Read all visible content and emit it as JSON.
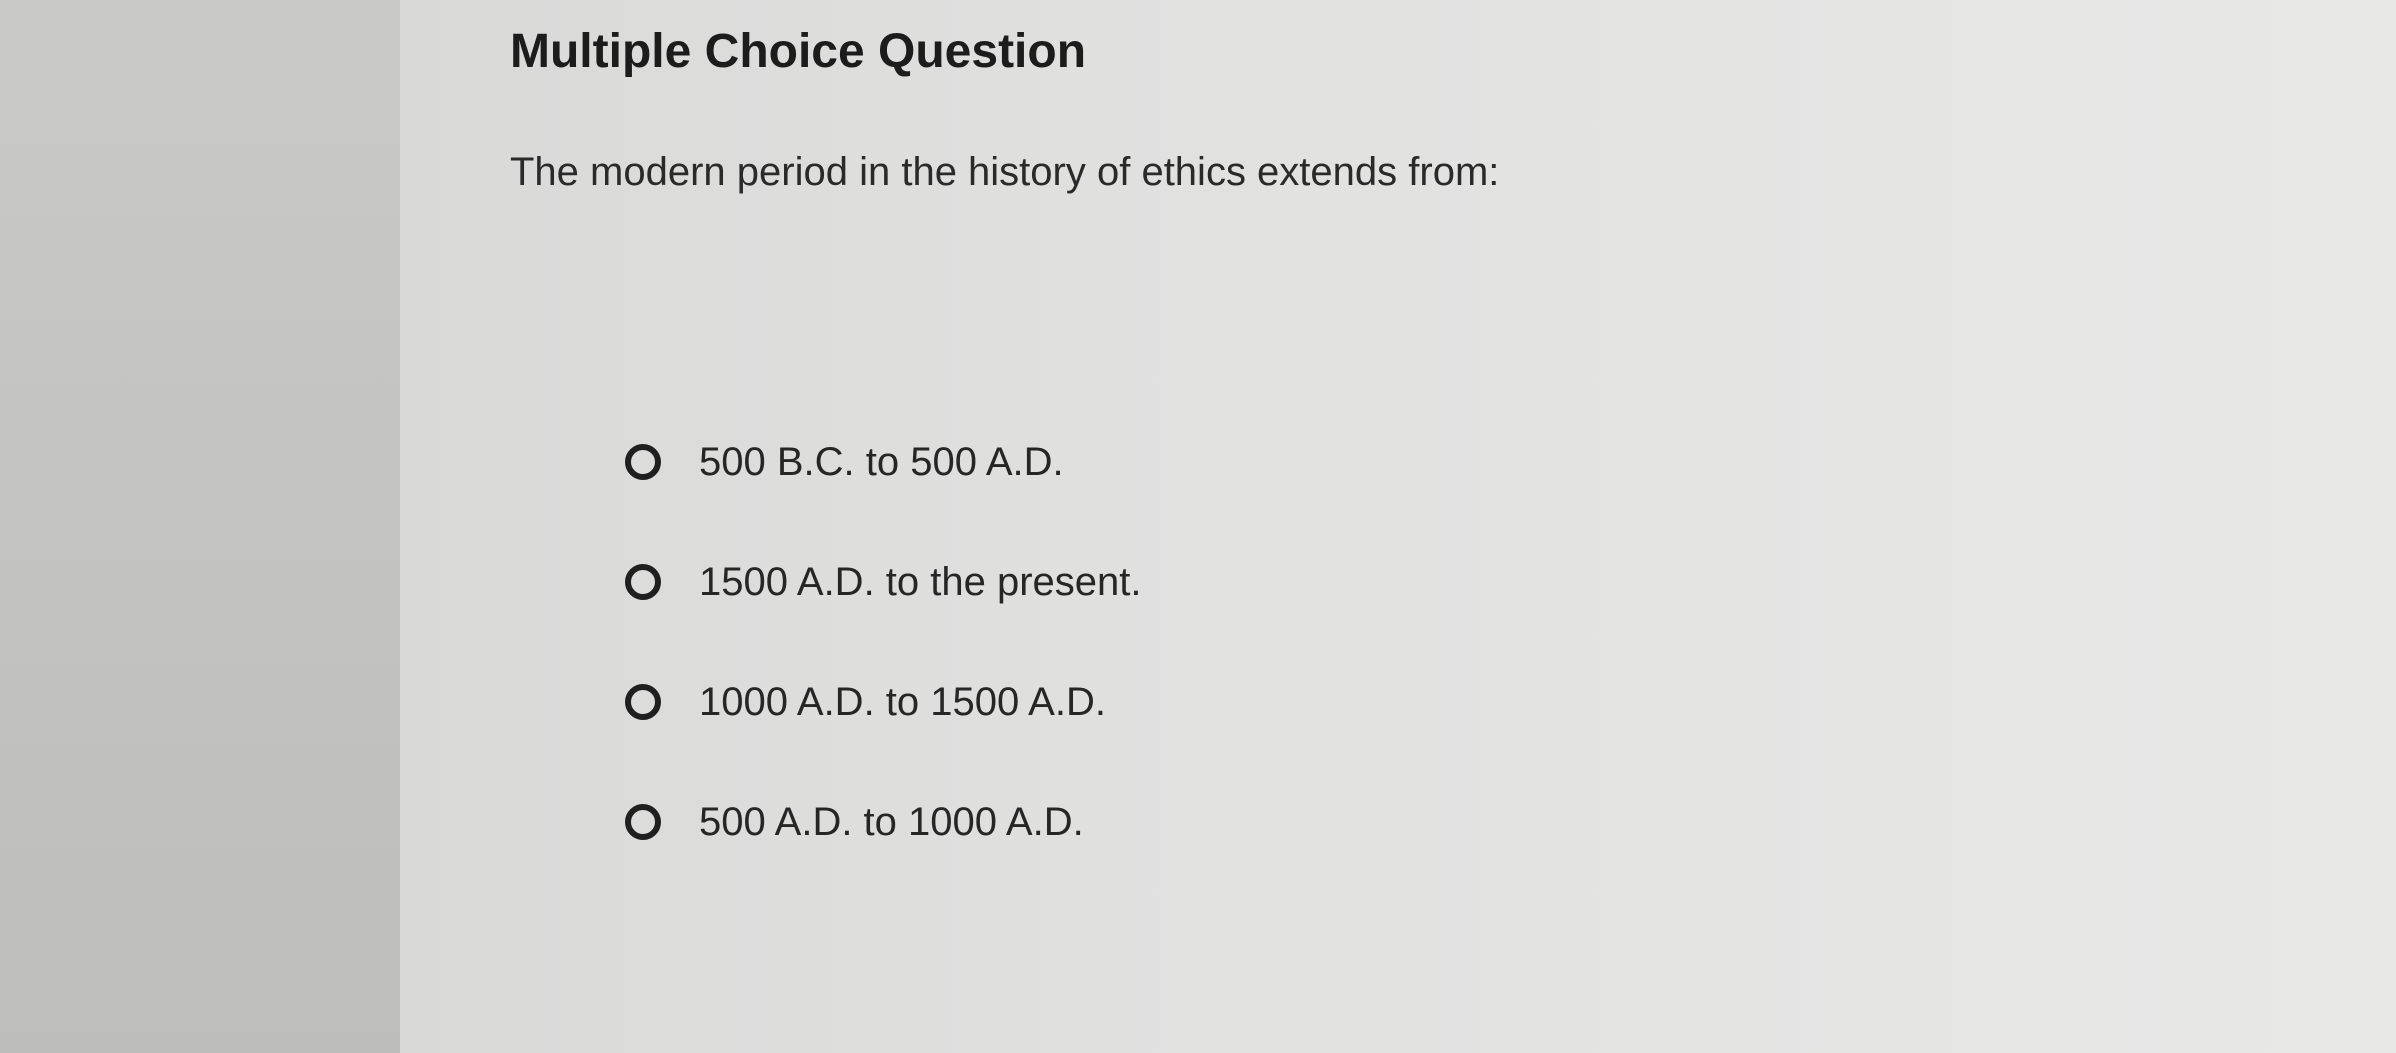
{
  "question": {
    "type_label": "Multiple Choice Question",
    "prompt": "The modern period in the history of ethics extends from:",
    "options": [
      {
        "label": "500 B.C. to 500 A.D."
      },
      {
        "label": "1500 A.D. to the present."
      },
      {
        "label": "1000 A.D. to 1500 A.D."
      },
      {
        "label": "500 A.D. to 1000 A.D."
      }
    ]
  },
  "colors": {
    "text": "#222222",
    "radio_border": "#1f1f1f",
    "background": "#e1e1e0"
  }
}
